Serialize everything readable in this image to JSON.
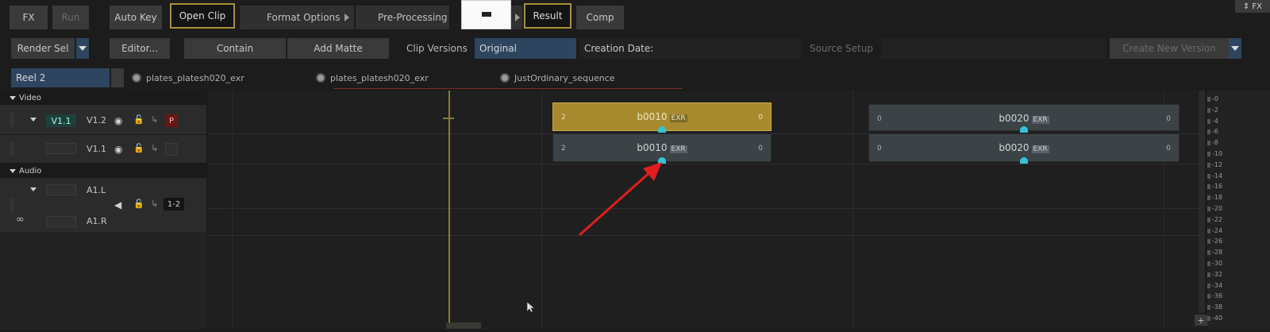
{
  "toolbar_top": {
    "fx_label": "FX",
    "run_label": "Run",
    "auto_key_label": "Auto Key",
    "open_clip_label": "Open Clip",
    "format_options_label": "Format Options",
    "pre_processing_label": "Pre-Processing",
    "result_label": "Result",
    "comp_label": "Comp",
    "right_fx_label": "FX"
  },
  "toolbar_second": {
    "render_sel_label": "Render Sel",
    "editor_label": "Editor...",
    "contain_label": "Contain",
    "add_matte_label": "Add Matte",
    "clip_versions_label": "Clip Versions",
    "clip_versions_value": "Original",
    "creation_date_label": "Creation Date:",
    "source_setup_label": "Source Setup",
    "create_new_version_label": "Create New Version"
  },
  "reel": {
    "reel_name": "Reel 2",
    "tabs": [
      "plates_platesh020_exr",
      "plates_platesh020_exr",
      "JustOrdinary_sequence"
    ]
  },
  "tracks": {
    "video_header": "Video",
    "audio_header": "Audio",
    "v_track_1_label": "V1.1",
    "v_track_1_alt": "V1.2",
    "p_badge": "P",
    "v_track_2_label": "V1.1",
    "a_track_1_label": "A1.L",
    "a_track_2_label": "A1.R",
    "a_channels": "1-2"
  },
  "clips": [
    {
      "name": "b0010",
      "tag": "EXR",
      "left_num": "2",
      "right_num": "0",
      "selected": true
    },
    {
      "name": "b0020",
      "tag": "EXR",
      "left_num": "0",
      "right_num": "0",
      "selected": false
    },
    {
      "name": "b0010",
      "tag": "EXR",
      "left_num": "2",
      "right_num": "0",
      "selected": false
    },
    {
      "name": "b0020",
      "tag": "EXR",
      "left_num": "0",
      "right_num": "0",
      "selected": false
    }
  ],
  "meter_ticks": [
    "-0",
    "-2",
    "-4",
    "-6",
    "-8",
    "-10",
    "-12",
    "-14",
    "-16",
    "-18",
    "-20",
    "-22",
    "-24",
    "-26",
    "-28",
    "-30",
    "-32",
    "-34",
    "-36",
    "-38",
    "-40"
  ],
  "colors": {
    "selected_clip": "#a78a2e",
    "clip": "#3c4347",
    "marker": "#34c3d8",
    "annotation_arrow": "#e01e1e",
    "accent_border": "#a8903a"
  }
}
